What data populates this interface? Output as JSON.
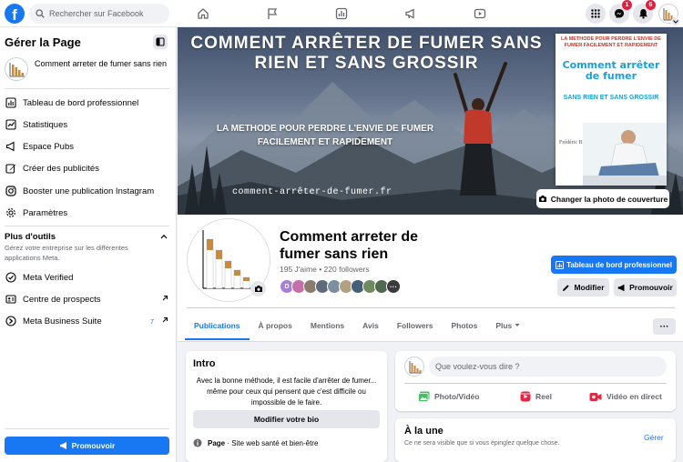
{
  "topbar": {
    "logo": "f",
    "search_placeholder": "Rechercher sur Facebook",
    "badges": {
      "messenger": "1",
      "notifications": "6"
    }
  },
  "sidebar": {
    "title": "Gérer la Page",
    "page_name": "Comment arreter de fumer sans rien",
    "items": [
      {
        "label": "Tableau de bord professionnel",
        "icon": "dashboard-icon"
      },
      {
        "label": "Statistiques",
        "icon": "stats-icon"
      },
      {
        "label": "Espace Pubs",
        "icon": "megaphone-icon"
      },
      {
        "label": "Créer des publicités",
        "icon": "edit-icon"
      },
      {
        "label": "Booster une publication Instagram",
        "icon": "instagram-icon"
      },
      {
        "label": "Paramètres",
        "icon": "gear-icon"
      }
    ],
    "tools_title": "Plus d'outils",
    "tools_desc": "Gérez votre entreprise sur les différentes applications Meta.",
    "tools": [
      {
        "label": "Meta Verified",
        "icon": "verified-icon"
      },
      {
        "label": "Centre de prospects",
        "icon": "leads-icon"
      },
      {
        "label": "Meta Business Suite",
        "icon": "business-suite-icon",
        "count": "7"
      }
    ],
    "promote": "Promouvoir"
  },
  "cover": {
    "title": "COMMENT ARRÊTER DE FUMER SANS RIEN ET SANS GROSSIR",
    "subtitle": "LA METHODE POUR PERDRE L'ENVIE DE FUMER FACILEMENT ET RAPIDEMENT",
    "url": "comment-arrêter-de-fumer.fr",
    "book_top": "LA METHODE POUR PERDRE L'ENVIE DE FUMER FACILEMENT ET RAPIDEMENT",
    "book_title": "Comment arrêter de fumer",
    "book_subtitle": "SANS RIEN ET SANS GROSSIR",
    "book_author": "Frédéric BARTHE",
    "change_cover": "Changer la photo de couverture"
  },
  "profile": {
    "name": "Comment arreter de fumer sans rien",
    "stats": "195 J'aime • 220 followers",
    "friend_initial": "D",
    "dashboard_button": "Tableau de bord professionnel",
    "edit_button": "Modifier",
    "promote_button": "Promouvoir",
    "tabs": [
      "Publications",
      "À propos",
      "Mentions",
      "Avis",
      "Followers",
      "Photos",
      "Plus"
    ],
    "more_dots": "···"
  },
  "intro": {
    "title": "Intro",
    "text": "Avec la bonne méthode, il est facile d'arrêter de fumer... même pour ceux qui pensent que c'est difficile ou impossible de le faire.",
    "edit_bio": "Modifier votre bio",
    "category_label": "Page",
    "category_value": "· Site web santé et bien-être"
  },
  "composer": {
    "placeholder": "Que voulez-vous dire ?",
    "actions": [
      {
        "label": "Photo/Vidéo",
        "color": "#45bd62"
      },
      {
        "label": "Reel",
        "color": "#e42645"
      },
      {
        "label": "Vidéo en direct",
        "color": "#e42645"
      }
    ]
  },
  "featured": {
    "title": "À la une",
    "desc": "Ce ne sera visible que si vous épinglez quelque chose.",
    "manage": "Gérer"
  },
  "colors": {
    "accent": "#1877f2",
    "background": "#f0f2f5"
  }
}
